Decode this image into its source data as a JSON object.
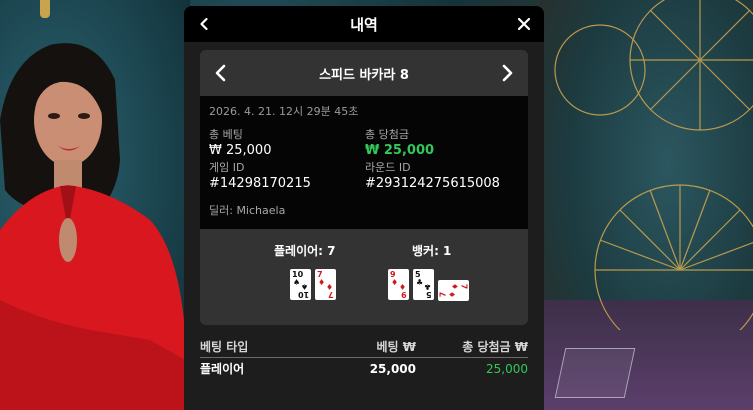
{
  "panel": {
    "title": "내역",
    "back_icon": "chevron-left-icon",
    "close_icon": "close-icon"
  },
  "round": {
    "game_name": "스피드 바카라 8",
    "timestamp": "2026. 4. 21. 12시 29분 45초",
    "total_bet_label": "총 베팅",
    "total_bet_value": "₩ 25,000",
    "total_win_label": "총 당첨금",
    "total_win_value": "₩ 25,000",
    "game_id_label": "게임 ID",
    "game_id_value": "#14298170215",
    "round_id_label": "라운드 ID",
    "round_id_value": "#293124275615008",
    "dealer": "딜러: Michaela"
  },
  "result": {
    "player_label": "플레이어: 7",
    "banker_label": "뱅커: 1",
    "player_cards": [
      {
        "rank": "10",
        "suit": "♠",
        "color": "black"
      },
      {
        "rank": "7",
        "suit": "♦",
        "color": "red"
      }
    ],
    "banker_cards": [
      {
        "rank": "9",
        "suit": "♦",
        "color": "red"
      },
      {
        "rank": "5",
        "suit": "♣",
        "color": "black"
      },
      {
        "rank": "7",
        "suit": "♦",
        "color": "red"
      }
    ]
  },
  "bets": {
    "headers": [
      "베팅 타입",
      "베팅 ₩",
      "총 당첨금 ₩"
    ],
    "rows": [
      {
        "type": "플레이어",
        "bet": "25,000",
        "win": "25,000"
      }
    ]
  },
  "colors": {
    "win_green": "#34c759",
    "panel_bg": "#1d1d1d",
    "card_bg": "#333333"
  }
}
